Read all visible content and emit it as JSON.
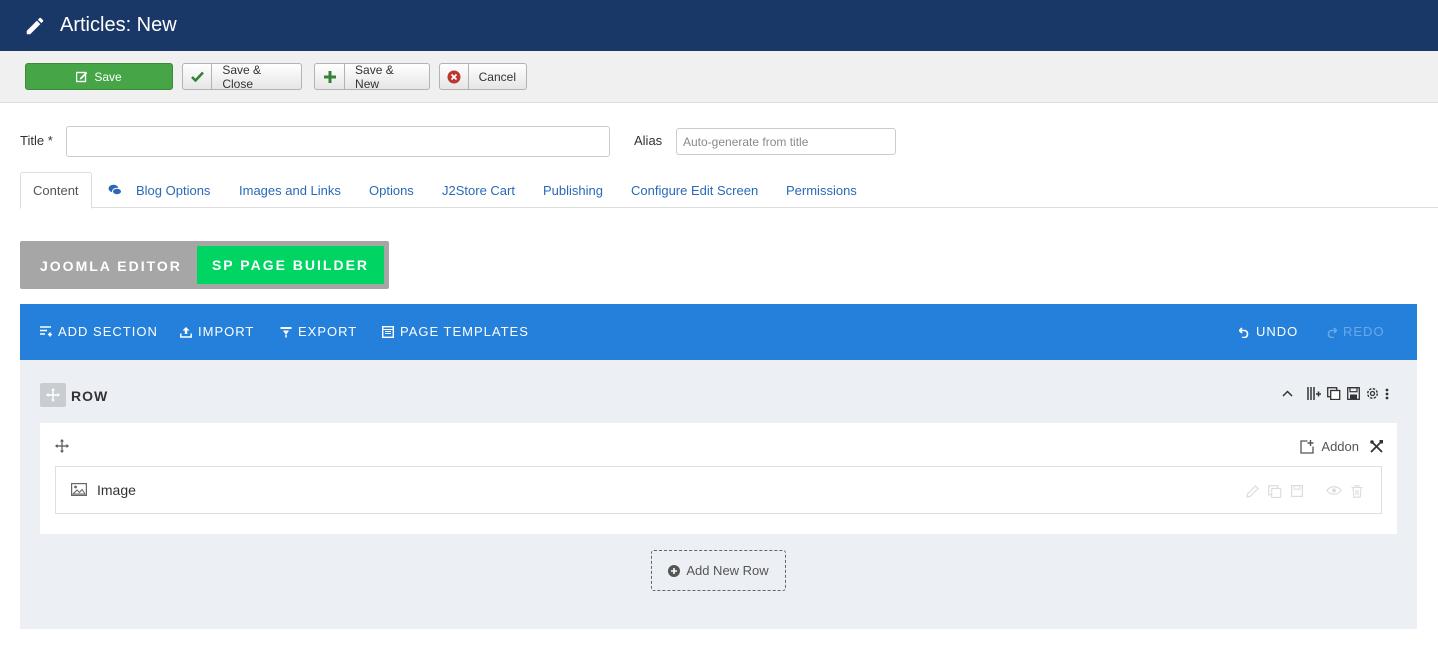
{
  "header": {
    "title": "Articles: New",
    "icon": "pencil-icon",
    "bg": "#1a3867"
  },
  "toolbar": {
    "save": "Save",
    "save_close": "Save & Close",
    "save_new": "Save & New",
    "cancel": "Cancel"
  },
  "form": {
    "title_label": "Title *",
    "title_value": "",
    "alias_label": "Alias",
    "alias_placeholder": "Auto-generate from title"
  },
  "tabs": [
    {
      "label": "Content",
      "active": true
    },
    {
      "label": "Blog Options"
    },
    {
      "label": "Images and Links"
    },
    {
      "label": "Options"
    },
    {
      "label": "J2Store Cart"
    },
    {
      "label": "Publishing"
    },
    {
      "label": "Configure Edit Screen"
    },
    {
      "label": "Permissions"
    }
  ],
  "editor_switch": {
    "joomla": "JOOMLA EDITOR",
    "sppb": "SP PAGE BUILDER",
    "active_color": "#00d563"
  },
  "builder": {
    "add_section": "ADD SECTION",
    "import": "IMPORT",
    "export": "EXPORT",
    "page_templates": "PAGE TEMPLATES",
    "undo": "UNDO",
    "redo": "REDO",
    "bar_color": "#2480db"
  },
  "row": {
    "title": "ROW",
    "addon_button": "Addon",
    "addon": {
      "name": "Image"
    },
    "add_new_row": "Add New Row"
  }
}
